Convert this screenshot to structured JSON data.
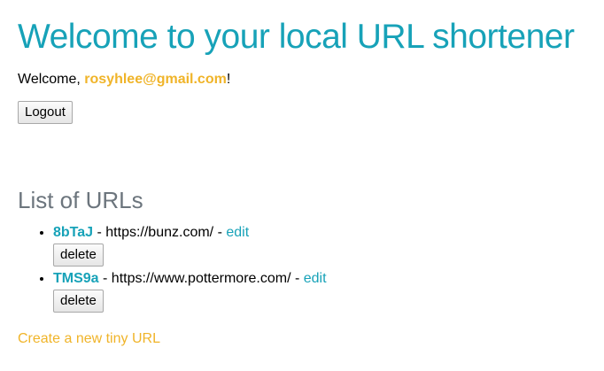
{
  "colors": {
    "teal": "#17a2b8",
    "gold": "#f0b429",
    "gray_heading": "#6c757d"
  },
  "header": {
    "title": "Welcome to your local URL shortener"
  },
  "welcome": {
    "prefix": "Welcome, ",
    "email": "rosyhlee@gmail.com",
    "suffix": "!"
  },
  "logout": {
    "label": "Logout"
  },
  "list": {
    "heading": "List of URLs",
    "items": [
      {
        "short": "8bTaJ",
        "sep1": " - ",
        "long_url": "https://bunz.com/",
        "sep2": " - ",
        "edit_label": "edit",
        "delete_label": "delete"
      },
      {
        "short": "TMS9a",
        "sep1": " - ",
        "long_url": "https://www.pottermore.com/",
        "sep2": " - ",
        "edit_label": "edit",
        "delete_label": "delete"
      }
    ]
  },
  "create_link": {
    "label": "Create a new tiny URL"
  }
}
